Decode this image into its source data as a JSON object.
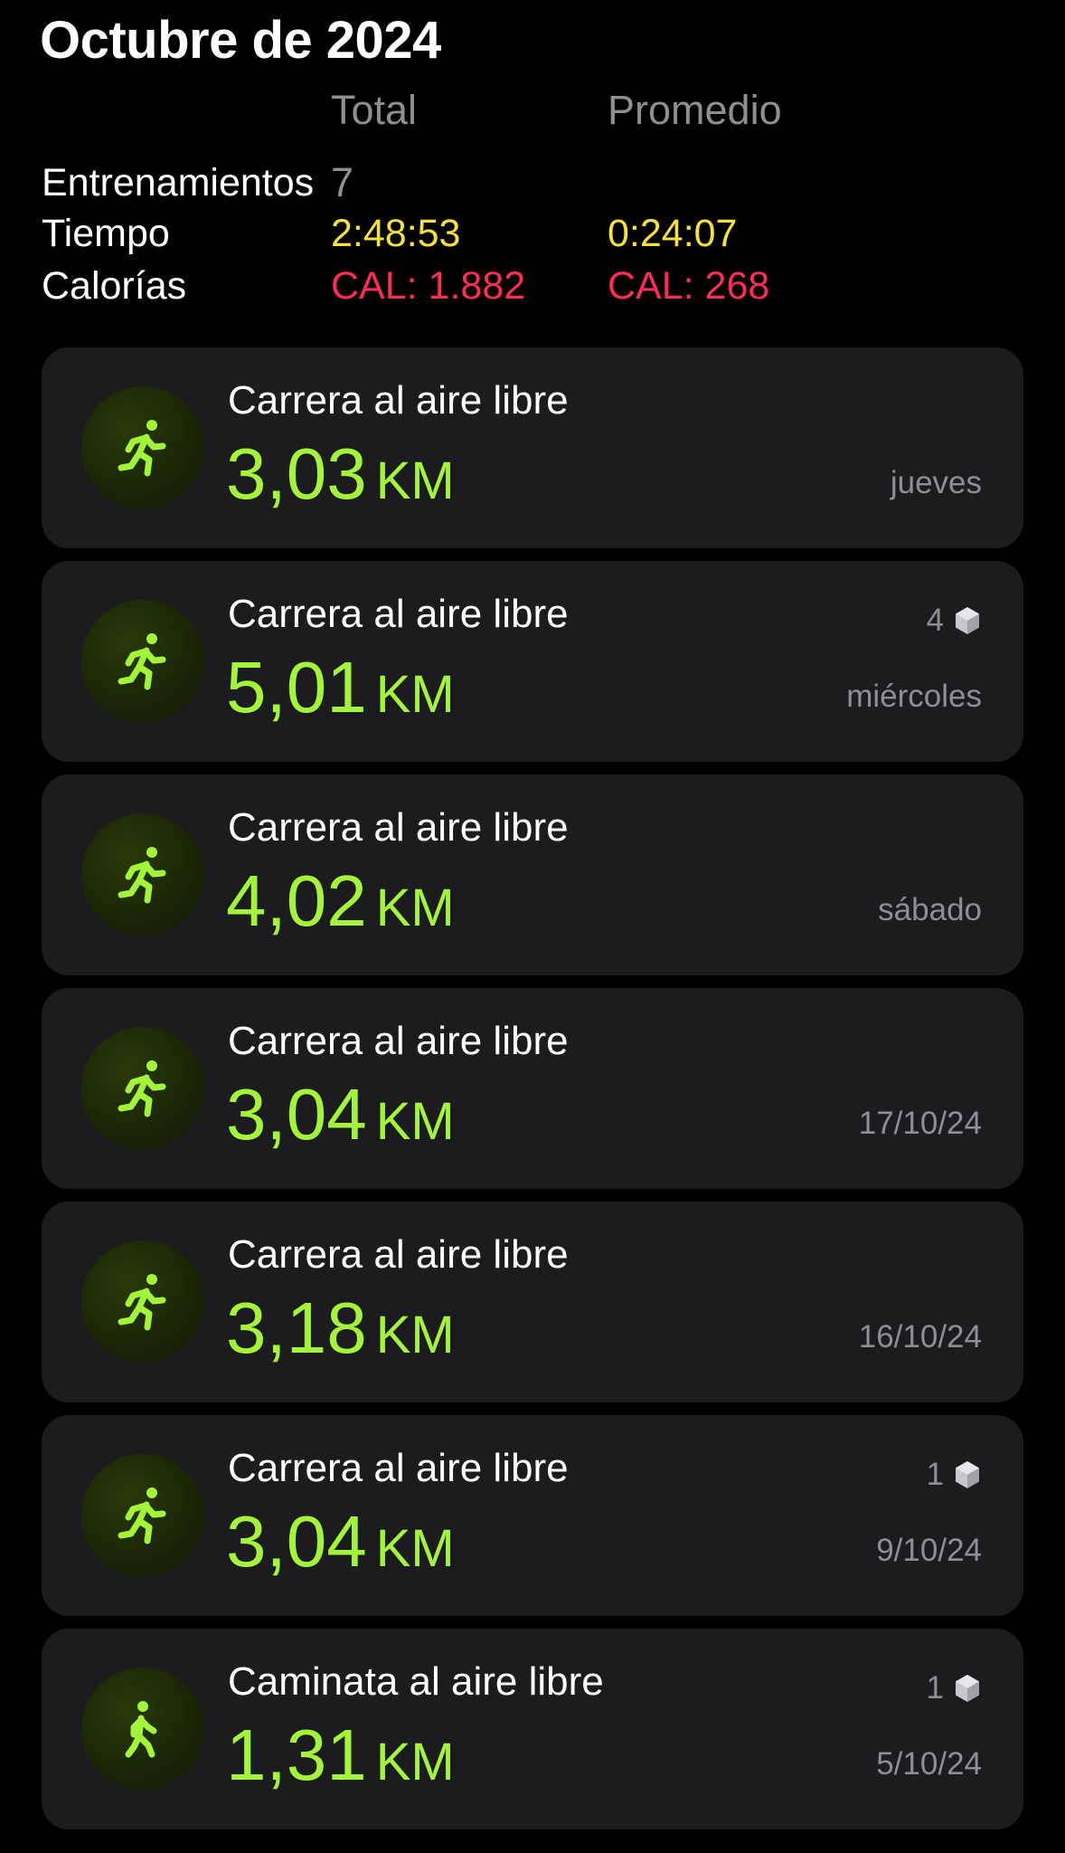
{
  "header": {
    "title": "Octubre de 2024"
  },
  "summary": {
    "columns": {
      "total": "Total",
      "average": "Promedio"
    },
    "workouts": {
      "label": "Entrenamientos",
      "total": "7"
    },
    "time": {
      "label": "Tiempo",
      "total": "2:48:53",
      "average": "0:24:07"
    },
    "calories": {
      "label": "Calorías",
      "total": "CAL: 1.882",
      "average": "CAL: 268"
    }
  },
  "colors": {
    "distance": "#a4f53a",
    "time": "#f6e23a",
    "calories": "#ff2d55",
    "secondary_text": "#8e8e93",
    "card_background": "#1c1c1e"
  },
  "workouts": [
    {
      "type": "Carrera al aire libre",
      "distance": "3,03",
      "unit": "KM",
      "date": "jueves",
      "badge": null,
      "icon": "running-figure-icon"
    },
    {
      "type": "Carrera al aire libre",
      "distance": "5,01",
      "unit": "KM",
      "date": "miércoles",
      "badge": "4",
      "icon": "running-figure-icon"
    },
    {
      "type": "Carrera al aire libre",
      "distance": "4,02",
      "unit": "KM",
      "date": "sábado",
      "badge": null,
      "icon": "running-figure-icon"
    },
    {
      "type": "Carrera al aire libre",
      "distance": "3,04",
      "unit": "KM",
      "date": "17/10/24",
      "badge": null,
      "icon": "running-figure-icon"
    },
    {
      "type": "Carrera al aire libre",
      "distance": "3,18",
      "unit": "KM",
      "date": "16/10/24",
      "badge": null,
      "icon": "running-figure-icon"
    },
    {
      "type": "Carrera al aire libre",
      "distance": "3,04",
      "unit": "KM",
      "date": "9/10/24",
      "badge": "1",
      "icon": "running-figure-icon"
    },
    {
      "type": "Caminata al aire libre",
      "distance": "1,31",
      "unit": "KM",
      "date": "5/10/24",
      "badge": "1",
      "icon": "walking-figure-icon"
    }
  ]
}
